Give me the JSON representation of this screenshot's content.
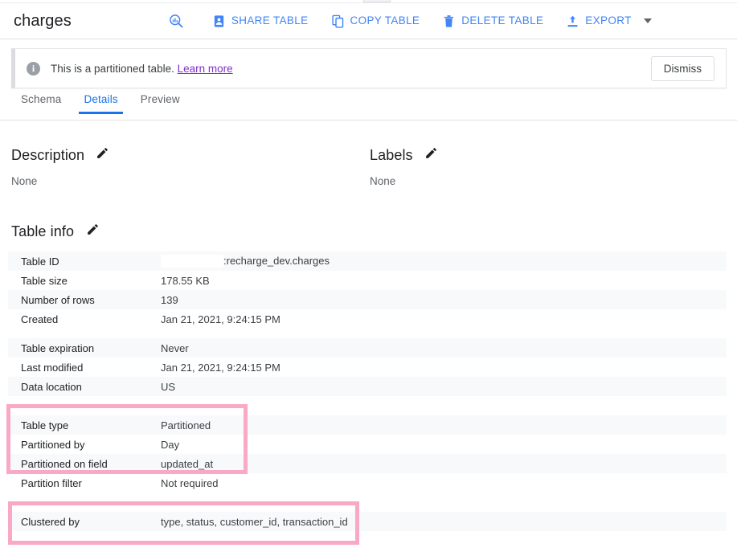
{
  "header": {
    "title": "charges",
    "toolbar": [
      {
        "label": "",
        "icon": "query-table-icon",
        "name": "query-table-button"
      },
      {
        "label": "SHARE TABLE",
        "icon": "share-table-icon",
        "name": "share-table-button"
      },
      {
        "label": "COPY TABLE",
        "icon": "copy-table-icon",
        "name": "copy-table-button"
      },
      {
        "label": "DELETE TABLE",
        "icon": "delete-table-icon",
        "name": "delete-table-button"
      },
      {
        "label": "EXPORT",
        "icon": "export-icon",
        "name": "export-button"
      }
    ],
    "accent_color": "#4285f4"
  },
  "banner": {
    "icon": "info-icon",
    "message": "This is a partitioned table.",
    "link_text": "Learn more",
    "link_color": "#8430ce",
    "dismiss_label": "Dismiss"
  },
  "tabs": [
    {
      "label": "Schema",
      "active": false
    },
    {
      "label": "Details",
      "active": true
    },
    {
      "label": "Preview",
      "active": false
    }
  ],
  "description": {
    "title": "Description",
    "edit_icon": "pencil-icon",
    "value": "None"
  },
  "labels": {
    "title": "Labels",
    "edit_icon": "pencil-icon",
    "value": "None"
  },
  "table_info": {
    "title": "Table info",
    "edit_icon": "pencil-icon",
    "rows": [
      {
        "label": "Table ID",
        "value": ":recharge_dev.charges",
        "redacted_prefix": true
      },
      {
        "label": "Table size",
        "value": "178.55 KB"
      },
      {
        "label": "Number of rows",
        "value": "139"
      },
      {
        "label": "Created",
        "value": "Jan 21, 2021, 9:24:15 PM"
      },
      {
        "label": "Table expiration",
        "value": "Never"
      },
      {
        "label": "Last modified",
        "value": "Jan 21, 2021, 9:24:15 PM"
      },
      {
        "label": "Data location",
        "value": "US"
      },
      {
        "label": "Table type",
        "value": "Partitioned"
      },
      {
        "label": "Partitioned by",
        "value": "Day"
      },
      {
        "label": "Partitioned on field",
        "value": "updated_at"
      },
      {
        "label": "Partition filter",
        "value": "Not required"
      },
      {
        "label": "Clustered by",
        "value": "type, status, customer_id, transaction_id"
      }
    ]
  },
  "annotations": {
    "highlight_color": "#f9a8c6",
    "boxes": [
      {
        "name": "partition-highlight",
        "covers": [
          "Table type",
          "Partitioned by",
          "Partitioned on field"
        ]
      },
      {
        "name": "clustered-highlight",
        "covers": [
          "Clustered by"
        ]
      }
    ]
  }
}
